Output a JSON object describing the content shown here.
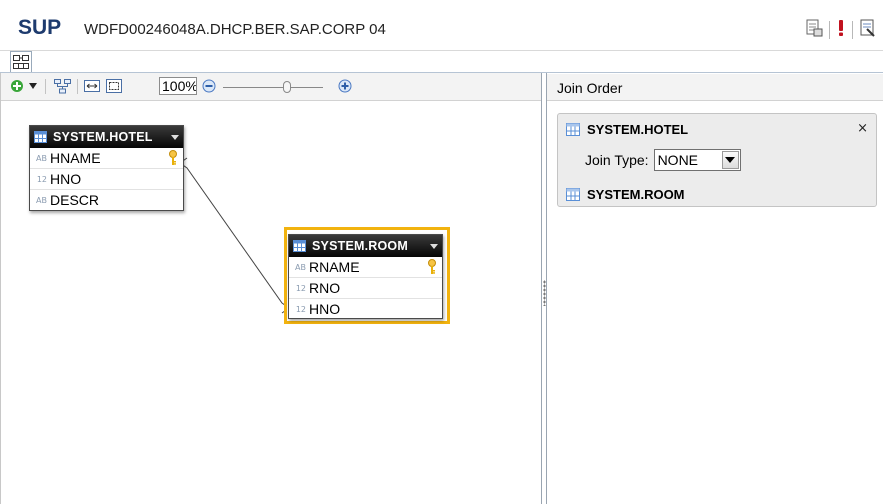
{
  "header": {
    "app_name": "SUP",
    "host": "WDFD00246048A.DHCP.BER.SAP.CORP 04",
    "icons": [
      "data-preview-icon",
      "error-icon",
      "doc-icon"
    ]
  },
  "editor_tab": {
    "icon": "join-diagram-icon"
  },
  "toolbar": {
    "zoom": "100%",
    "icons": [
      "add-table-icon",
      "dropdown-arrow-icon",
      "auto-layout-icon",
      "fit-width-icon",
      "fit-page-icon",
      "zoom-out-icon",
      "zoom-slider",
      "zoom-in-icon"
    ]
  },
  "tables": [
    {
      "name": "SYSTEM.HOTEL",
      "columns": [
        {
          "type": "AB",
          "name": "HNAME",
          "key": true
        },
        {
          "type": "12",
          "name": "HNO",
          "key": false
        },
        {
          "type": "AB",
          "name": "DESCR",
          "key": false
        }
      ]
    },
    {
      "name": "SYSTEM.ROOM",
      "selected": true,
      "columns": [
        {
          "type": "AB",
          "name": "RNAME",
          "key": true
        },
        {
          "type": "12",
          "name": "RNO",
          "key": false
        },
        {
          "type": "12",
          "name": "HNO",
          "key": false
        }
      ]
    }
  ],
  "join_order": {
    "title": "Join Order",
    "first_table": "SYSTEM.HOTEL",
    "join_type_label": "Join Type:",
    "join_type_value": "NONE",
    "second_table": "SYSTEM.ROOM",
    "close_label": "×"
  },
  "colors": {
    "brand": "#1e3b6e",
    "selection": "#f2b30f",
    "key": "#e8b00a",
    "table_header": "#111111"
  }
}
